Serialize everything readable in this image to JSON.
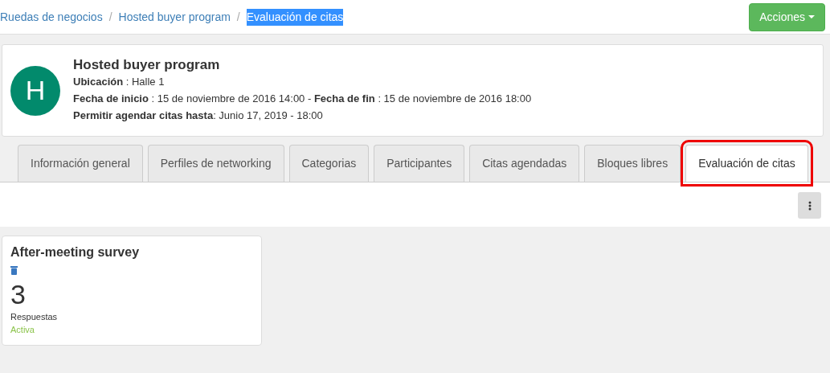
{
  "breadcrumb": [
    {
      "label": "Ruedas de negocios",
      "selected": false
    },
    {
      "separator": "/",
      "label": "Hosted buyer program",
      "selected": false
    },
    {
      "separator": "/",
      "label": "Evaluación de citas",
      "selected": true
    }
  ],
  "actions_button": {
    "label": "Acciones"
  },
  "event": {
    "avatar_letter": "H",
    "title": "Hosted buyer program",
    "lines": [
      "**Ubicación** : Halle 1",
      "**Fecha de inicio** : 15 de noviembre de 2016 14:00 - **Fecha de fin** : 15 de noviembre de 2016 18:00",
      "**Permitir agendar citas hasta**: Junio 17, 2019 - 18:00"
    ]
  },
  "tabs": [
    {
      "label": "Información general",
      "selected": false,
      "highlighted": false
    },
    {
      "label": "Perfiles de networking",
      "selected": false,
      "highlighted": false
    },
    {
      "label": "Categorias",
      "selected": false,
      "highlighted": false
    },
    {
      "label": "Participantes",
      "selected": false,
      "highlighted": false
    },
    {
      "label": "Citas agendadas",
      "selected": false,
      "highlighted": false
    },
    {
      "label": "Bloques libres",
      "selected": false,
      "highlighted": false
    },
    {
      "label": "Evaluación de citas",
      "selected": true,
      "highlighted": true
    }
  ],
  "surveys": [
    {
      "title": "After-meeting survey",
      "count": "3",
      "count_label": "Respuestas",
      "status": "Activa",
      "active": true
    }
  ]
}
